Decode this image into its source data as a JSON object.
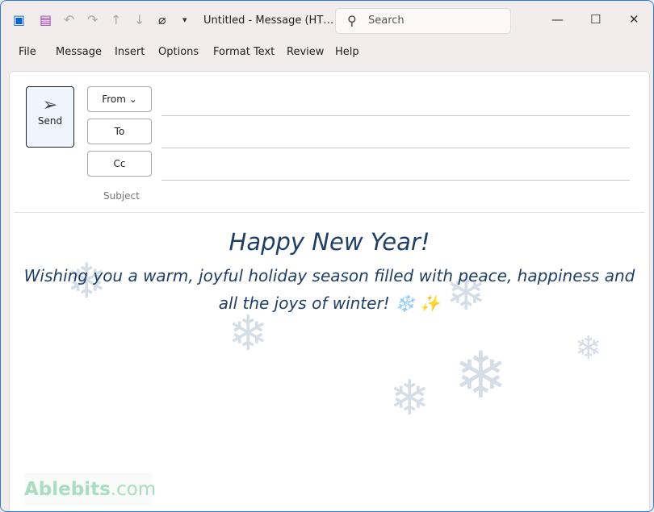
{
  "window": {
    "title": "Untitled  -  Message (HT…",
    "search_placeholder": "Search"
  },
  "quick_access": [
    "outlook-icon",
    "save-icon",
    "undo-icon",
    "redo-icon",
    "up-icon",
    "down-icon",
    "attach-icon",
    "customize-icon"
  ],
  "menu": [
    "File",
    "Message",
    "Insert",
    "Options",
    "Format Text",
    "Review",
    "Help"
  ],
  "compose": {
    "send": "Send",
    "from": "From",
    "to": "To",
    "cc": "Cc",
    "subject": "Subject"
  },
  "message": {
    "heading": "Happy New Year!",
    "line1": "Wishing you a warm, joyful holiday season filled with peace, happiness and",
    "line2": "all the joys of winter! ❄️ ✨"
  },
  "watermark": "Ablebits.com",
  "colors": {
    "accent": "#2d7be0",
    "text": "#1f3f66"
  }
}
